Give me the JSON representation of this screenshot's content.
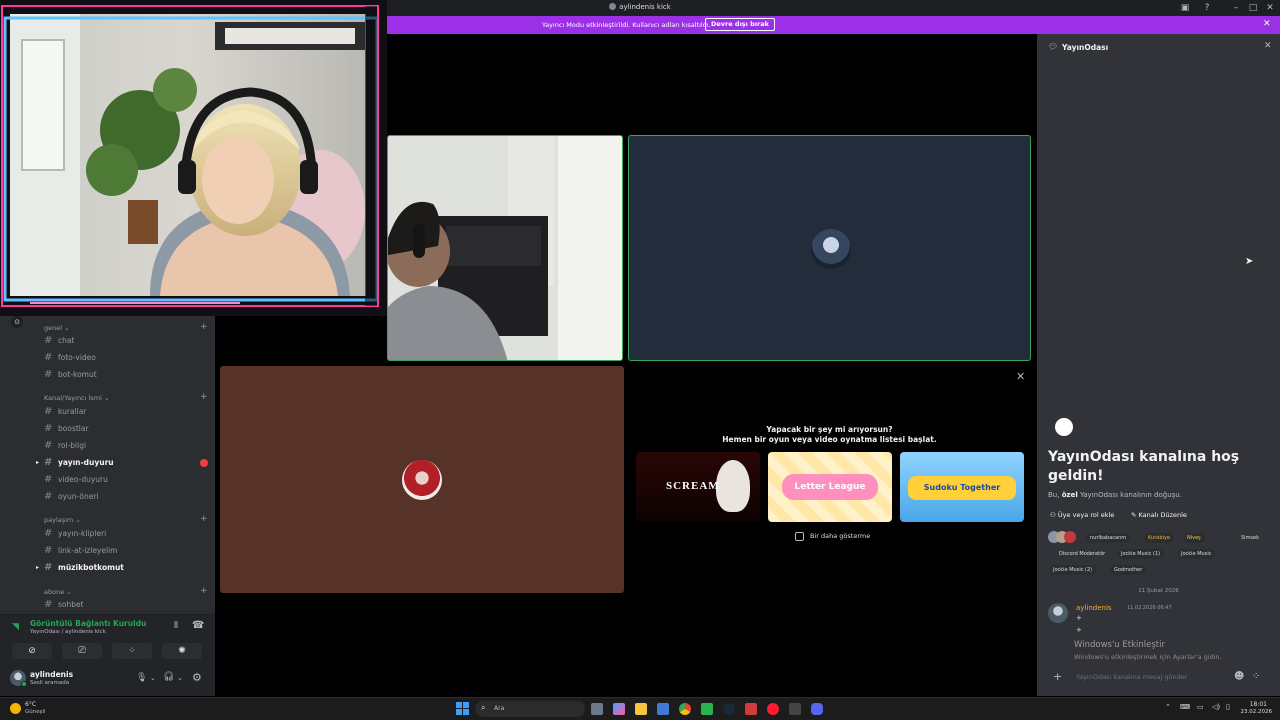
{
  "titlebar": {
    "title": "aylindenis kick"
  },
  "streamer_bar": {
    "message": "Yayıncı Modu etkinleştirildi. Kullanıcı adları kısaltıldı.",
    "button": "Devre dışı bırak"
  },
  "sidebar": {
    "categories": [
      {
        "label": "genel",
        "channels": [
          "chat",
          "foto-video",
          "bot-komut"
        ]
      },
      {
        "label": "Kanal/Yayıncı İsmi",
        "channels": [
          "kurallar",
          "boostlar",
          "rol-bilgi",
          "yayın-duyuru",
          "video-duyuru",
          "oyun-öneri"
        ]
      },
      {
        "label": "paylaşım",
        "channels": [
          "yayın-klipleri",
          "link-at-izleyelim",
          "müzikbotkomut"
        ]
      },
      {
        "label": "abone",
        "channels": [
          "sohbet"
        ]
      }
    ]
  },
  "voice": {
    "status": "Görüntülü Bağlantı Kuruldu",
    "location": "YayınOdası / aylindenis kick"
  },
  "user": {
    "name": "aylindenis",
    "status": "Sesli aramada"
  },
  "activity": {
    "line1": "Yapacak bir şey mi arıyorsun?",
    "line2": "Hemen bir oyun veya video oynatma listesi başlat.",
    "cards": [
      "SCREAM",
      "Letter League",
      "Sudoku Together"
    ],
    "checkbox": "Bir daha gösterme"
  },
  "panel": {
    "header": "YayınOdası",
    "welcome": "YayınOdası kanalına hoş geldin!",
    "subtitle_pre": "Bu, ",
    "subtitle_bold": "özel",
    "subtitle_post": " YayınOdası kanalının doğuşu.",
    "actions": [
      "Üye veya rol ekle",
      "Kanalı Düzenle"
    ],
    "tags_row1": [
      "nurlbabacanm",
      "Kurabiye",
      "Niveş",
      "Simsek"
    ],
    "tags_row2": [
      "Discord Moderatör",
      "Jockie Music (1)",
      "Jockie Music"
    ],
    "tags_row3": [
      "Jockie Music (2)",
      "Godmother"
    ],
    "date_divider": "11 Şubat 2026",
    "message": {
      "author": "aylindenis",
      "time": "11.02.2026 06:47",
      "lines": [
        "+",
        "+"
      ]
    },
    "activation": {
      "title": "Windows'u Etkinleştir",
      "body": "Windows'u etkinleştirmek için Ayarlar'a gidin."
    },
    "input_placeholder": "YayınOdası kanalına mesaj gönder"
  },
  "taskbar": {
    "weather_temp": "6°C",
    "weather_text": "Güneşli",
    "search": "Ara",
    "time": "18:01",
    "date": "23.02.2026"
  }
}
